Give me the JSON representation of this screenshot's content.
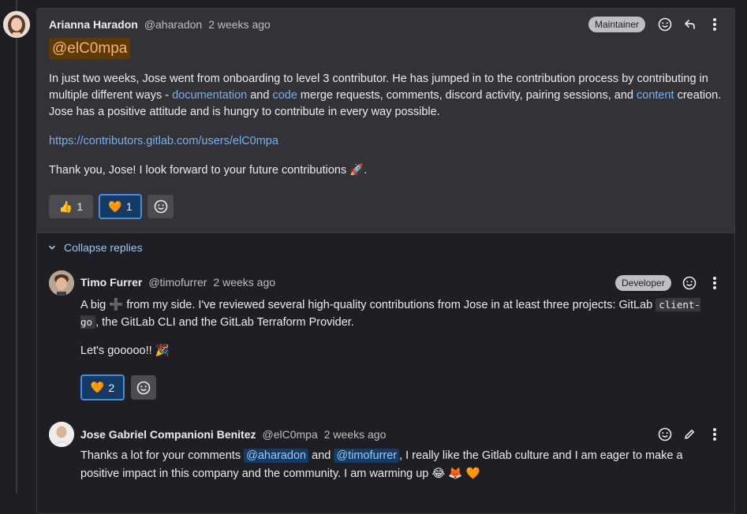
{
  "main_comment": {
    "author": "Arianna Haradon",
    "handle": "@aharadon",
    "time": "2 weeks ago",
    "role": "Maintainer",
    "mention": "@elC0mpa",
    "paragraph": {
      "p1": "In just two weeks, Jose went from onboarding to level 3 contributor. He has jumped in to the contribution process by contributing in multiple different ways - ",
      "link1": "documentation",
      "p2": " and ",
      "link2": "code",
      "p3": " merge requests, comments, discord activity, pairing sessions, and ",
      "link3": "content",
      "p4": " creation. Jose has a positive attitude and is hungry to contribute in every way possible."
    },
    "url": "https://contributors.gitlab.com/users/elC0mpa",
    "thanks": "Thank you, Jose! I look forward to your future contributions 🚀.",
    "reactions": [
      {
        "emoji": "👍",
        "count": "1"
      },
      {
        "emoji": "🧡",
        "count": "1"
      }
    ]
  },
  "collapse_label": "Collapse replies",
  "reply1": {
    "author": "Timo Furrer",
    "handle": "@timofurrer",
    "time": "2 weeks ago",
    "role": "Developer",
    "line1_a": "A big ",
    "line1_emoji": "➕",
    "line1_b": " from my side. I've reviewed several high-quality contributions from Jose in at least three projects: GitLab ",
    "code": "client-go",
    "line1_c": ", the GitLab CLI and the GitLab Terraform Provider.",
    "line2": "Let's gooooo!! 🎉",
    "reaction": {
      "emoji": "🧡",
      "count": "2"
    }
  },
  "reply2": {
    "author": "Jose Gabriel Companioni Benitez",
    "handle": "@elC0mpa",
    "time": "2 weeks ago",
    "t1": "Thanks a lot for your comments ",
    "m1": "@aharadon",
    "t2": " and ",
    "m2": "@timofurrer",
    "t3": ", I really like the Gitlab culture and I am eager to make a positive impact in this company and the community. I am warming up 😂 🦊 🧡"
  },
  "colors": {
    "page_bg": "#1f1e24",
    "card_bg": "#333238",
    "link": "#7ab0ea",
    "mention_bg": "#5c3a0a",
    "active_reaction_border": "#428fdc"
  }
}
